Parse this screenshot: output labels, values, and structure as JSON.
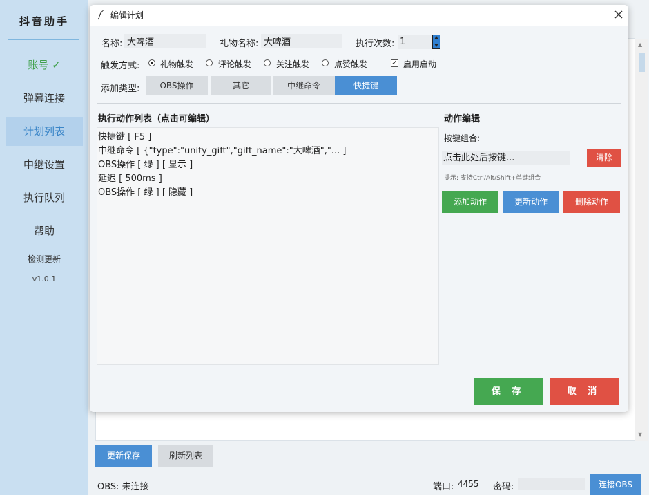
{
  "sidebar": {
    "app_title": "抖音助手",
    "items": [
      {
        "label": "账号 ✓"
      },
      {
        "label": "弹幕连接"
      },
      {
        "label": "计划列表"
      },
      {
        "label": "中继设置"
      },
      {
        "label": "执行队列"
      },
      {
        "label": "帮助"
      }
    ],
    "check_update": "检测更新",
    "version": "v1.0.1"
  },
  "main": {
    "update_save_label": "更新保存",
    "refresh_list_label": "刷新列表"
  },
  "status_bar": {
    "obs_status": "OBS: 未连接",
    "port_label": "端口:",
    "port_value": "4455",
    "password_label": "密码:",
    "password_value": "",
    "connect_label": "连接OBS"
  },
  "dialog": {
    "title": "编辑计划",
    "name_label": "名称:",
    "name_value": "大啤酒",
    "gift_name_label": "礼物名称:",
    "gift_name_value": "大啤酒",
    "exec_count_label": "执行次数:",
    "exec_count_value": "1",
    "trigger_label": "触发方式:",
    "triggers": [
      {
        "label": "礼物触发",
        "checked": true
      },
      {
        "label": "评论触发",
        "checked": false
      },
      {
        "label": "关注触发",
        "checked": false
      },
      {
        "label": "点赞触发",
        "checked": false
      }
    ],
    "enable_start_label": "启用启动",
    "enable_start_checked": true,
    "add_type_label": "添加类型:",
    "add_types": [
      {
        "label": "OBS操作",
        "active": false
      },
      {
        "label": "其它",
        "active": false
      },
      {
        "label": "中继命令",
        "active": false
      },
      {
        "label": "快捷键",
        "active": true
      }
    ],
    "action_list_title": "执行动作列表（点击可编辑）",
    "actions": [
      "快捷键 [ F5 ]",
      "中继命令 [ {\"type\":\"unity_gift\",\"gift_name\":\"大啤酒\",\"... ]",
      "OBS操作 [ 绿 ] [ 显示 ]",
      "延迟 [ 500ms ]",
      "OBS操作 [ 绿 ] [ 隐藏 ]"
    ],
    "editor_title": "动作编辑",
    "key_combo_label": "按键组合:",
    "key_combo_placeholder": "点击此处后按键...",
    "clear_label": "清除",
    "hint_text": "提示: 支持Ctrl/Alt/Shift+单键组合",
    "add_action_label": "添加动作",
    "update_action_label": "更新动作",
    "delete_action_label": "删除动作",
    "save_label": "保 存",
    "cancel_label": "取 消"
  },
  "colors": {
    "accent_blue": "#4a8fd4",
    "success_green": "#45a851",
    "danger_red": "#e05144",
    "sidebar_bg": "#c9dff1",
    "account_green": "#3fa04a"
  }
}
